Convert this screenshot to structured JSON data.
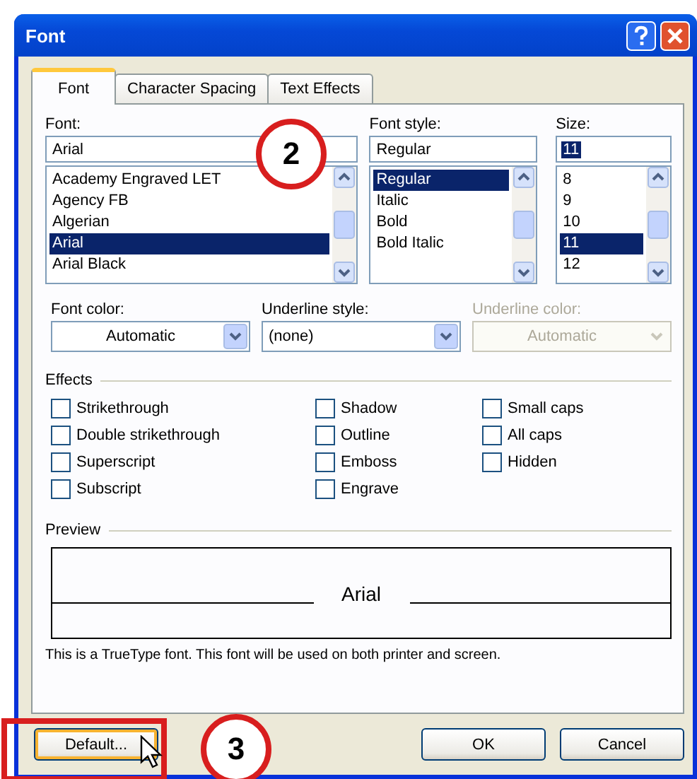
{
  "window": {
    "title": "Font"
  },
  "tabs": [
    {
      "label": "Font",
      "selected": true
    },
    {
      "label": "Character Spacing",
      "selected": false
    },
    {
      "label": "Text Effects",
      "selected": false
    }
  ],
  "font": {
    "label": "Font:",
    "value": "Arial",
    "items": [
      {
        "label": "Academy Engraved LET",
        "selected": false
      },
      {
        "label": "Agency FB",
        "selected": false
      },
      {
        "label": "Algerian",
        "selected": false
      },
      {
        "label": "Arial",
        "selected": true
      },
      {
        "label": "Arial Black",
        "selected": false
      }
    ]
  },
  "font_style": {
    "label": "Font style:",
    "value": "Regular",
    "items": [
      {
        "label": "Regular",
        "selected": true
      },
      {
        "label": "Italic",
        "selected": false
      },
      {
        "label": "Bold",
        "selected": false
      },
      {
        "label": "Bold Italic",
        "selected": false
      }
    ]
  },
  "size": {
    "label": "Size:",
    "value": "11",
    "items": [
      {
        "label": "8",
        "selected": false
      },
      {
        "label": "9",
        "selected": false
      },
      {
        "label": "10",
        "selected": false
      },
      {
        "label": "11",
        "selected": true
      },
      {
        "label": "12",
        "selected": false
      }
    ]
  },
  "combos": [
    {
      "label": "Font color:",
      "value": "Automatic",
      "disabled": false,
      "centered": true
    },
    {
      "label": "Underline style:",
      "value": "(none)",
      "disabled": false,
      "centered": false
    },
    {
      "label": "Underline color:",
      "value": "Automatic",
      "disabled": true,
      "centered": true
    }
  ],
  "effects": {
    "title": "Effects",
    "options": [
      {
        "label": "Strikethrough",
        "checked": false
      },
      {
        "label": "Double strikethrough",
        "checked": false
      },
      {
        "label": "Superscript",
        "checked": false
      },
      {
        "label": "Subscript",
        "checked": false
      },
      {
        "label": "Shadow",
        "checked": false
      },
      {
        "label": "Outline",
        "checked": false
      },
      {
        "label": "Emboss",
        "checked": false
      },
      {
        "label": "Engrave",
        "checked": false
      },
      {
        "label": "Small caps",
        "checked": false
      },
      {
        "label": "All caps",
        "checked": false
      },
      {
        "label": "Hidden",
        "checked": false
      }
    ]
  },
  "preview": {
    "title": "Preview",
    "sample": "Arial",
    "note": "This is a TrueType font. This font will be used on both printer and screen."
  },
  "buttons": [
    {
      "label": "Default...",
      "kind": "left"
    },
    {
      "label": "OK",
      "kind": "right"
    },
    {
      "label": "Cancel",
      "kind": "right"
    }
  ],
  "annotations": [
    {
      "kind": "circle",
      "label": "2"
    },
    {
      "kind": "frame"
    },
    {
      "kind": "circle",
      "label": "3"
    },
    {
      "kind": "cursor"
    }
  ]
}
